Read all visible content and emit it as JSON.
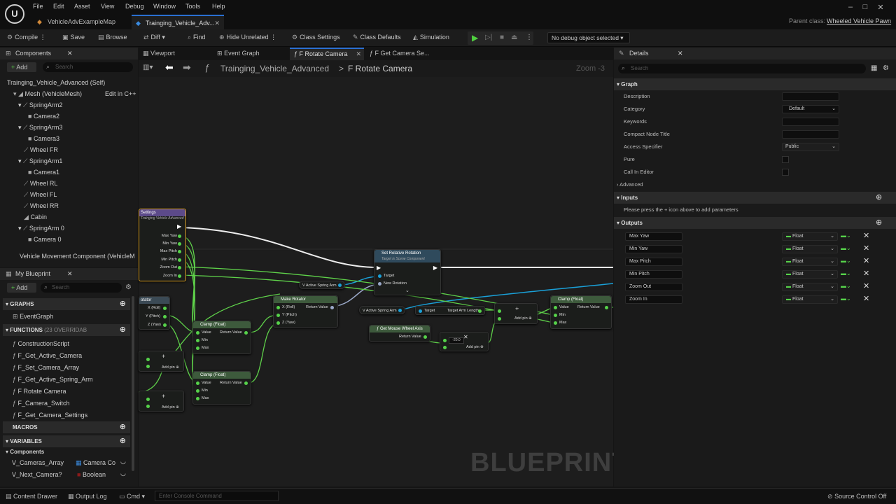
{
  "menu": [
    "File",
    "Edit",
    "Asset",
    "View",
    "Debug",
    "Window",
    "Tools",
    "Help"
  ],
  "doc_tabs": [
    "VehicleAdvExampleMap",
    "Trainging_Vehicle_Adv..."
  ],
  "parent_class_label": "Parent class:",
  "parent_class_value": "Wheeled Vehicle Pawn",
  "toolbar": {
    "compile": "Compile",
    "save": "Save",
    "browse": "Browse",
    "diff": "Diff",
    "find": "Find",
    "hide_unrelated": "Hide Unrelated",
    "class_settings": "Class Settings",
    "class_defaults": "Class Defaults",
    "simulation": "Simulation",
    "debug_object": "No debug object selected"
  },
  "components": {
    "title": "Components",
    "add": "Add",
    "search_placeholder": "Search",
    "self": "Trainging_Vehicle_Advanced (Self)",
    "mesh": "Mesh (VehicleMesh)",
    "edit_cpp": "Edit in C++",
    "items": [
      "SpringArm2",
      "Camera2",
      "SpringArm3",
      "Camera3",
      "Wheel FR",
      "SpringArm1",
      "Camera1",
      "Wheel RL",
      "Wheel FL",
      "Wheel RR",
      "Cabin",
      "SpringArm 0",
      "Camera 0"
    ],
    "movement": "Vehicle Movement Component (VehicleM"
  },
  "my_blueprint": {
    "title": "My Blueprint",
    "add": "Add",
    "search_placeholder": "Search",
    "graphs": "GRAPHS",
    "event_graph": "EventGraph",
    "functions": "FUNCTIONS",
    "functions_count": "(23 OVERRIDAB",
    "function_items": [
      "ConstructionScript",
      "F_Get_Active_Camera",
      "F_Set_Camera_Array",
      "F_Get_Active_Spring_Arm",
      "F Rotate Camera",
      "F_Camera_Switch",
      "F_Get_Camera_Settings"
    ],
    "macros": "MACROS",
    "variables": "VARIABLES",
    "components_label": "Components",
    "variables_list": [
      {
        "name": "V_Cameras_Array",
        "type": "Camera Co"
      },
      {
        "name": "V_Next_Camera?",
        "type": "Boolean"
      }
    ]
  },
  "graph_tabs": [
    "Viewport",
    "Event Graph",
    "F Rotate Camera",
    "F Get Camera Se..."
  ],
  "graph": {
    "breadcrumb_root": "Trainging_Vehicle_Advanced",
    "breadcrumb_sep": ">",
    "breadcrumb_current": "F Rotate Camera",
    "zoom": "Zoom -3",
    "watermark": "BLUEPRINT"
  },
  "nodes": {
    "entry": {
      "title": "Settings",
      "subtitle": "Trainging Vehicle Advanced",
      "pins": [
        "Max Yaw",
        "Min Yaw",
        "Max Pitch",
        "Min Pitch",
        "Zoom Out",
        "Zoom In"
      ]
    },
    "set_rel_rot": {
      "title": "Set Relative Rotation",
      "subtitle": "Target is Scene Component",
      "pins": [
        "Target",
        "New Rotation"
      ]
    },
    "make_rot": {
      "title": "Make Rotator",
      "pins": [
        "X (Roll)",
        "Y (Pitch)",
        "Z (Yaw)"
      ],
      "out": "Return Value"
    },
    "break_rot": {
      "title": "otator",
      "pins": [
        "X (Roll)",
        "Y (Pitch)",
        "Z (Yaw)"
      ]
    },
    "clamp1": {
      "title": "Clamp (Float)",
      "pins": [
        "Value",
        "Min",
        "Max"
      ],
      "out": "Return Value"
    },
    "clamp2": {
      "title": "Clamp (Float)",
      "pins": [
        "Value",
        "Min",
        "Max"
      ],
      "out": "Return Value"
    },
    "clamp3": {
      "title": "Clamp (Float)",
      "pins": [
        "Value",
        "Min",
        "Max"
      ],
      "out": "Return Value"
    },
    "v_active1": "V Active Spring Arm",
    "v_active2": "V Active Spring Arm",
    "target": "Target",
    "target_arm": "Target Arm Length",
    "mouse": {
      "title": "Get Mouse Wheel Axis",
      "out": "Return Value"
    },
    "mult_value": "-20.0",
    "add_pin": "Add pin"
  },
  "details": {
    "title": "Details",
    "search_placeholder": "Search",
    "graph": "Graph",
    "rows": [
      {
        "label": "Description",
        "value": ""
      },
      {
        "label": "Category",
        "value": "Default"
      },
      {
        "label": "Keywords",
        "value": ""
      },
      {
        "label": "Compact Node Title",
        "value": ""
      },
      {
        "label": "Access Specifier",
        "value": "Public"
      },
      {
        "label": "Pure",
        "value": ""
      },
      {
        "label": "Call In Editor",
        "value": ""
      }
    ],
    "advanced": "Advanced",
    "inputs": "Inputs",
    "inputs_hint": "Please press the + icon above to add parameters",
    "outputs": "Outputs",
    "outputs_list": [
      {
        "name": "Max Yaw",
        "type": "Float"
      },
      {
        "name": "Min Yaw",
        "type": "Float"
      },
      {
        "name": "Max Pitch",
        "type": "Float"
      },
      {
        "name": "Min Pitch",
        "type": "Float"
      },
      {
        "name": "Zoom Out",
        "type": "Float"
      },
      {
        "name": "Zoom In",
        "type": "Float"
      }
    ]
  },
  "status": {
    "content_drawer": "Content Drawer",
    "output_log": "Output Log",
    "cmd": "Cmd",
    "console_placeholder": "Enter Console Command",
    "source_control": "Source Control Off"
  },
  "colors": {
    "accent": "#2a6fd1",
    "pin_float": "#56d24a",
    "exec_wire": "#ffffff",
    "object_wire": "#1aa0d8"
  }
}
